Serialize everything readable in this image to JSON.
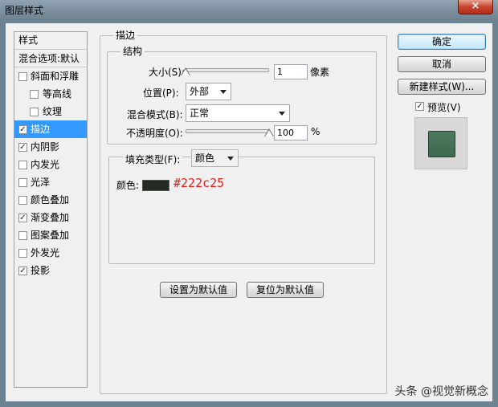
{
  "window": {
    "title": "图层样式",
    "close_glyph": "×"
  },
  "style_list": {
    "header": "样式",
    "blend_options": "混合选项:默认",
    "items": [
      {
        "label": "斜面和浮雕",
        "checked": false,
        "sub": false,
        "selected": false
      },
      {
        "label": "等高线",
        "checked": false,
        "sub": true,
        "selected": false
      },
      {
        "label": "纹理",
        "checked": false,
        "sub": true,
        "selected": false
      },
      {
        "label": "描边",
        "checked": true,
        "sub": false,
        "selected": true
      },
      {
        "label": "内阴影",
        "checked": true,
        "sub": false,
        "selected": false
      },
      {
        "label": "内发光",
        "checked": false,
        "sub": false,
        "selected": false
      },
      {
        "label": "光泽",
        "checked": false,
        "sub": false,
        "selected": false
      },
      {
        "label": "颜色叠加",
        "checked": false,
        "sub": false,
        "selected": false
      },
      {
        "label": "渐变叠加",
        "checked": true,
        "sub": false,
        "selected": false
      },
      {
        "label": "图案叠加",
        "checked": false,
        "sub": false,
        "selected": false
      },
      {
        "label": "外发光",
        "checked": false,
        "sub": false,
        "selected": false
      },
      {
        "label": "投影",
        "checked": true,
        "sub": false,
        "selected": false
      }
    ]
  },
  "stroke": {
    "section_title": "描边",
    "structure": {
      "title": "结构",
      "size_label": "大小(S):",
      "size_value": "1",
      "size_unit": "像素",
      "size_fraction": 0.0,
      "position_label": "位置(P):",
      "position_value": "外部",
      "blend_mode_label": "混合模式(B):",
      "blend_mode_value": "正常",
      "opacity_label": "不透明度(O):",
      "opacity_value": "100",
      "opacity_unit": "%",
      "opacity_fraction": 1.0
    },
    "fill": {
      "fill_type_label": "填充类型(F):",
      "fill_type_value": "颜色",
      "color_label": "颜色:",
      "color_hex": "#222c25"
    },
    "set_default": "设置为默认值",
    "reset_default": "复位为默认值"
  },
  "right_panel": {
    "ok": "确定",
    "cancel": "取消",
    "new_style": "新建样式(W)...",
    "preview_label": "预览(V)",
    "preview_checked": true,
    "preview_color": "#4e7a5e"
  },
  "watermark": "头条 @视觉新概念",
  "colors": {
    "selection": "#3399ff",
    "stroke_color": "#222c25",
    "hex_text": "#e02020"
  }
}
